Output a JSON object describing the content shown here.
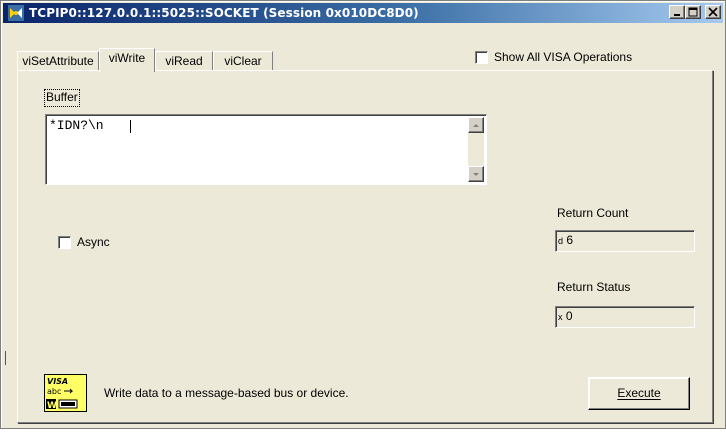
{
  "window": {
    "title": "TCPIP0::127.0.0.1::5025::SOCKET (Session 0x010DC8D0)"
  },
  "tabs": [
    {
      "label": "viSetAttribute",
      "active": false
    },
    {
      "label": "viWrite",
      "active": true
    },
    {
      "label": "viRead",
      "active": false
    },
    {
      "label": "viClear",
      "active": false
    }
  ],
  "show_all": {
    "label": "Show All VISA Operations",
    "checked": false
  },
  "buffer": {
    "label": "Buffer",
    "value": "*IDN?\\n"
  },
  "async": {
    "label": "Async",
    "checked": false
  },
  "return_count": {
    "label": "Return Count",
    "format": "d",
    "value": "6"
  },
  "return_status": {
    "label": "Return Status",
    "format": "x",
    "value": "0"
  },
  "description": "Write data to a message-based bus or device.",
  "execute_label": "Execute",
  "icons": {
    "title": "visa-session-icon",
    "operation": "visa-write-icon",
    "visa_icon_text": [
      "VISA",
      "abc",
      "W"
    ]
  },
  "colors": {
    "titlebar_start": "#0a246a",
    "titlebar_end": "#a6caf0",
    "face": "#ece9d8",
    "icon_bg": "#ffff66"
  }
}
